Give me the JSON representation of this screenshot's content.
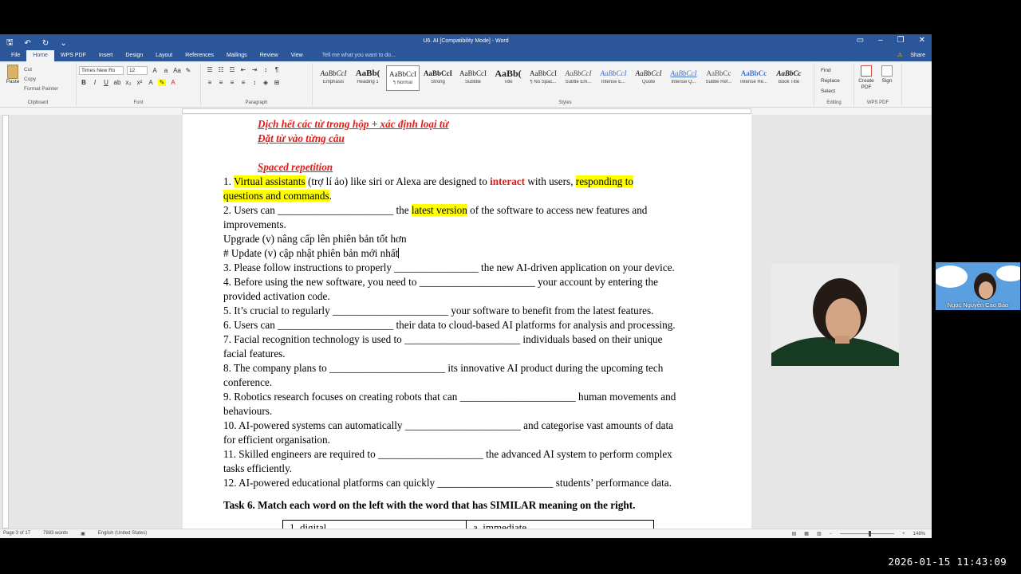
{
  "window": {
    "title": "U6. AI [Compatibility Mode] - Word",
    "tabs": [
      "File",
      "Home",
      "WPS PDF",
      "Insert",
      "Design",
      "Layout",
      "References",
      "Mailings",
      "Review",
      "View"
    ],
    "tell_me": "Tell me what you want to do...",
    "share": "Share"
  },
  "ribbon": {
    "clipboard": {
      "paste": "Paste",
      "cut": "Cut",
      "copy": "Copy",
      "format_painter": "Format Painter",
      "label": "Clipboard"
    },
    "font": {
      "name": "Times New Ro",
      "size": "12",
      "label": "Font"
    },
    "paragraph": {
      "label": "Paragraph"
    },
    "styles": {
      "label": "Styles",
      "items": [
        {
          "preview": "AaBbCcI",
          "name": "Emphasis"
        },
        {
          "preview": "AaBb(",
          "name": "Heading 1"
        },
        {
          "preview": "AaBbCcI",
          "name": "¶ Normal"
        },
        {
          "preview": "AaBbCcI",
          "name": "Strong"
        },
        {
          "preview": "AaBbCcI",
          "name": "Subtitle"
        },
        {
          "preview": "AaBb(",
          "name": "Title"
        },
        {
          "preview": "AaBbCcI",
          "name": "¶ No Spac..."
        },
        {
          "preview": "AaBbCcI",
          "name": "Subtle Em..."
        },
        {
          "preview": "AaBbCcI",
          "name": "Intense E..."
        },
        {
          "preview": "AaBbCcI",
          "name": "Quote"
        },
        {
          "preview": "AaBbCcI",
          "name": "Intense Q..."
        },
        {
          "preview": "AaBbCc",
          "name": "Subtle Ref..."
        },
        {
          "preview": "AaBbCc",
          "name": "Intense Re..."
        },
        {
          "preview": "AaBbCc",
          "name": "Book Title"
        }
      ]
    },
    "editing": {
      "find": "Find",
      "replace": "Replace",
      "select": "Select",
      "label": "Editing"
    },
    "wps": {
      "create": "Create PDF",
      "sign": "Sign",
      "label": "WPS PDF"
    }
  },
  "document": {
    "heading1": "Dịch hết các từ trong hộp + xác định loại từ",
    "heading2": "Đặt từ vào từng câu",
    "heading3": "Spaced repetition",
    "line1_a": "1. ",
    "line1_hl1": "Virtual assistants",
    "line1_b": " (trợ lí ảo) like siri or Alexa are designed to ",
    "line1_red": "interact",
    "line1_c": " with users, ",
    "line1_hl2": "responding to",
    "line1_hl3": "questions and commands",
    "line1_d": ".",
    "line2_a": "2. Users can ______________________ the ",
    "line2_hl": "latest version",
    "line2_b": " of the software to access new features and",
    "line2_c": "improvements.",
    "upgrade": "Upgrade (v) nâng cấp lên phiên bản tốt hơn",
    "update": "# Update (v) cập nhật phiên bản mới nhất",
    "lines": [
      "3. Please follow instructions to properly ________________ the new AI-driven application on your device.",
      "4. Before using the new software, you need to ______________________ your account by entering the",
      "provided activation code.",
      "5. It’s crucial to regularly ______________________ your software to benefit from the latest features.",
      "6. Users can ______________________ their data to cloud-based AI platforms for analysis and processing.",
      "7. Facial recognition technology is used to ______________________ individuals based on their unique",
      "facial features.",
      "8. The company plans to ______________________ its innovative AI product during the upcoming tech",
      "conference.",
      "9. Robotics research focuses on creating robots that can ______________________ human movements and",
      "behaviours.",
      "10. AI-powered systems can automatically ______________________ and categorise vast amounts of data",
      "for efficient organisation.",
      "11. Skilled engineers are required to ____________________ the advanced AI system to perform complex",
      "tasks efficiently.",
      "12. AI-powered educational platforms can quickly ______________________ students’ performance data."
    ],
    "task6": "Task 6. Match each word on the left with the word that has SIMILAR meaning on the right.",
    "table_left": "1. digital",
    "table_right": "a. immediate"
  },
  "status": {
    "page": "Page 3 of 17",
    "words": "7983 words",
    "language": "English (United States)",
    "zoom": "148%"
  },
  "webcam": {
    "name": "Ngọc Nguyễn Cao Bảo"
  },
  "timestamp": "2026-01-15 11:43:09"
}
